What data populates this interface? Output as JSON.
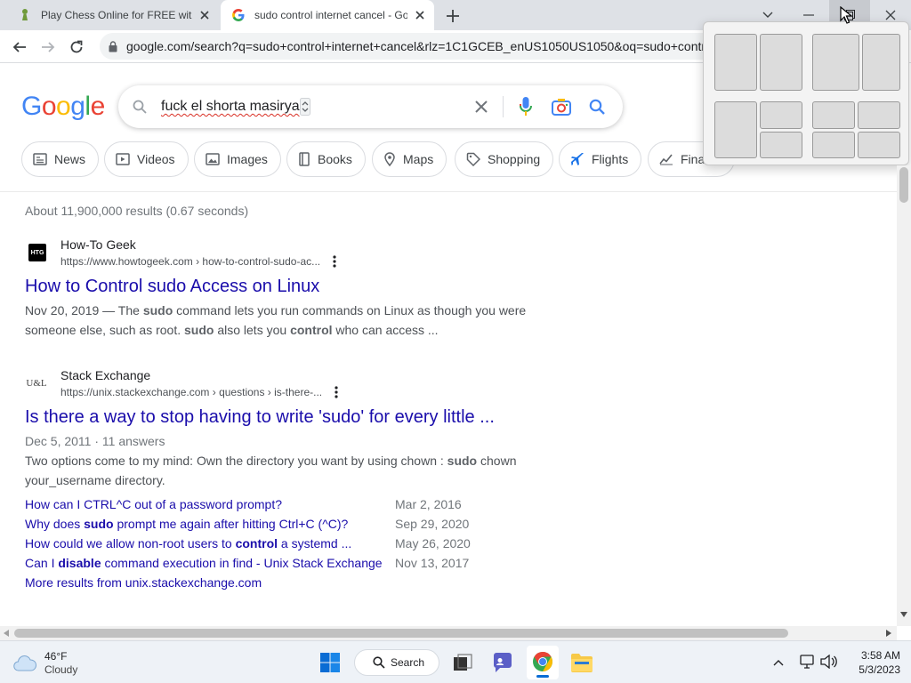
{
  "browser": {
    "tabs": [
      {
        "title": "Play Chess Online for FREE with F"
      },
      {
        "title": "sudo control internet cancel - Go"
      }
    ],
    "address": "google.com/search?q=sudo+control+internet+cancel&rlz=1C1GCEB_enUS1050US1050&oq=sudo+contr"
  },
  "google": {
    "logo": "Google",
    "query": "fuck el shorta masirya",
    "chips": [
      "News",
      "Videos",
      "Images",
      "Books",
      "Maps",
      "Shopping",
      "Flights",
      "Fina"
    ],
    "stats": "About 11,900,000 results (0.67 seconds)"
  },
  "results": [
    {
      "site": "How-To Geek",
      "favicon_text": "HTG",
      "cite": "https://www.howtogeek.com › how-to-control-sudo-ac...",
      "title": "How to Control sudo Access on Linux",
      "snippet_parts": [
        {
          "t": "Nov 20, 2019 — The ",
          "b": false
        },
        {
          "t": "sudo",
          "b": true
        },
        {
          "t": " command lets you run commands on Linux as though you were someone else, such as root. ",
          "b": false
        },
        {
          "t": "sudo",
          "b": true
        },
        {
          "t": " also lets you ",
          "b": false
        },
        {
          "t": "control",
          "b": true
        },
        {
          "t": " who can access ...",
          "b": false
        }
      ]
    },
    {
      "site": "Stack Exchange",
      "favicon_text": "U&L",
      "cite": "https://unix.stackexchange.com › questions › is-there-...",
      "title": "Is there a way to stop having to write 'sudo' for every little ...",
      "meta": "Dec 5, 2011 · 11 answers",
      "snippet_parts": [
        {
          "t": "Two options come to my mind: Own the directory you want by using chown : ",
          "b": false
        },
        {
          "t": "sudo",
          "b": true
        },
        {
          "t": " chown your_username directory.",
          "b": false
        }
      ],
      "sublinks": [
        {
          "parts": [
            {
              "t": "How can I CTRL^C out of a password prompt?",
              "b": false
            }
          ],
          "date": "Mar 2, 2016"
        },
        {
          "parts": [
            {
              "t": "Why does ",
              "b": false
            },
            {
              "t": "sudo",
              "b": true
            },
            {
              "t": " prompt me again after hitting Ctrl+C (^C)?",
              "b": false
            }
          ],
          "date": "Sep 29, 2020"
        },
        {
          "parts": [
            {
              "t": "How could we allow non-root users to ",
              "b": false
            },
            {
              "t": "control",
              "b": true
            },
            {
              "t": " a systemd ...",
              "b": false
            }
          ],
          "date": "May 26, 2020"
        },
        {
          "parts": [
            {
              "t": "Can I ",
              "b": false
            },
            {
              "t": "disable",
              "b": true
            },
            {
              "t": " command execution in find - Unix Stack Exchange",
              "b": false
            }
          ],
          "date": "Nov 13, 2017"
        }
      ],
      "more": "More results from unix.stackexchange.com"
    }
  ],
  "taskbar": {
    "weather_temp": "46°F",
    "weather_desc": "Cloudy",
    "search_label": "Search",
    "time": "3:58 AM",
    "date": "5/3/2023"
  },
  "colors": {
    "link": "#1a0dab",
    "google_blue": "#4285f4",
    "google_red": "#ea4335",
    "google_yellow": "#fbbc05",
    "google_green": "#34a853"
  }
}
